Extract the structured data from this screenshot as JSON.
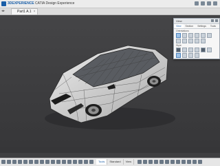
{
  "app": {
    "brand": "3DEXPERIENCE",
    "title": "CATIA Design Experience",
    "doc_tab": "Part1 A.1"
  },
  "view_panel": {
    "title": "View",
    "tabs": [
      "View",
      "Section",
      "Settings",
      "Tools"
    ],
    "active_tab": "View",
    "section_orientations": "Orientations",
    "section_style": "Style"
  },
  "bottom_bar": {
    "tabs": [
      "Tools",
      "Standard",
      "View"
    ],
    "active_tab": "Tools"
  },
  "colors": {
    "viewport_bg": "#3f3f41",
    "accent": "#1b5fa8",
    "car_body": "#d9d9d9"
  },
  "icons": [
    "3ds-logo",
    "share-icon",
    "search-icon",
    "gear-icon",
    "close-icon",
    "compass-icon"
  ]
}
